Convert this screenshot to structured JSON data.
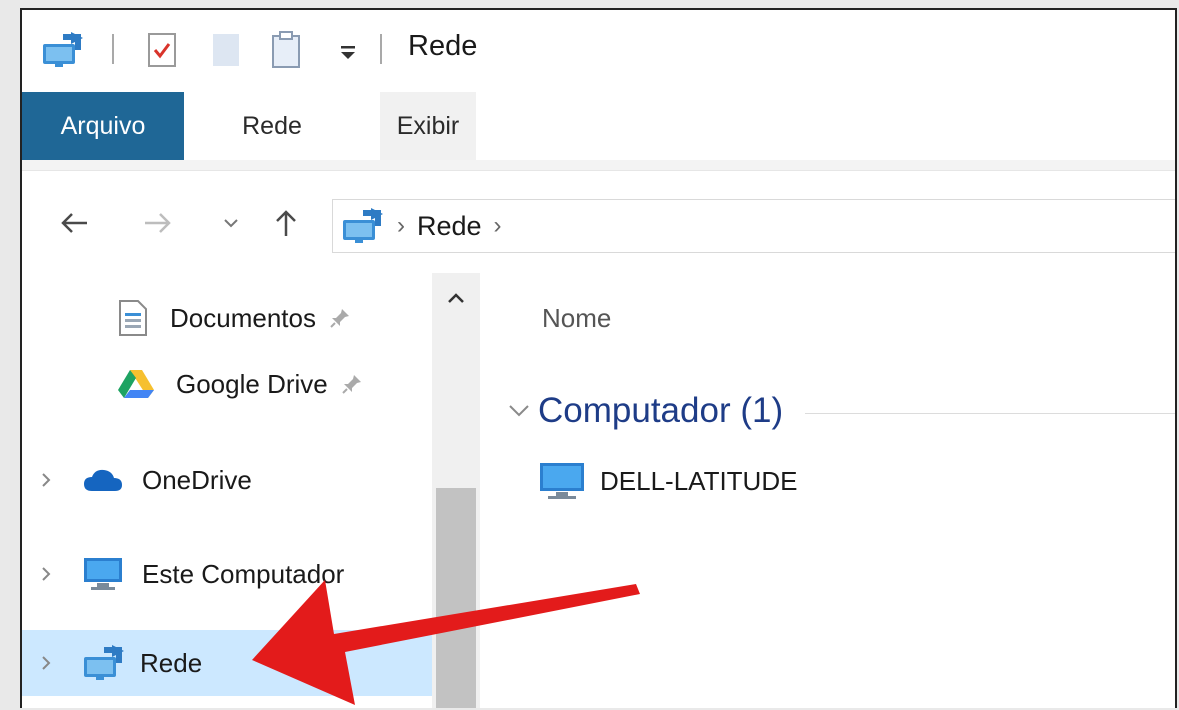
{
  "window": {
    "title": "Rede"
  },
  "ribbon": {
    "tabs": [
      {
        "label": "Arquivo"
      },
      {
        "label": "Rede"
      },
      {
        "label": "Exibir"
      }
    ]
  },
  "address": {
    "crumbs": [
      "Rede"
    ]
  },
  "sidebar": {
    "items": [
      {
        "label": "Documentos",
        "icon": "document-icon",
        "pinned": true
      },
      {
        "label": "Google Drive",
        "icon": "google-drive-icon",
        "pinned": true
      },
      {
        "label": "OneDrive",
        "icon": "cloud-icon"
      },
      {
        "label": "Este Computador",
        "icon": "computer-icon"
      },
      {
        "label": "Rede",
        "icon": "network-icon",
        "selected": true
      }
    ]
  },
  "content": {
    "column_header": "Nome",
    "group": {
      "label": "Computador (1)"
    },
    "entries": [
      {
        "label": "DELL-LATITUDE",
        "icon": "computer-icon"
      }
    ]
  },
  "colors": {
    "file_tab": "#1f6796",
    "selection": "#cce8ff",
    "group_text": "#1e3c87",
    "arrow": "#e31b1b"
  }
}
